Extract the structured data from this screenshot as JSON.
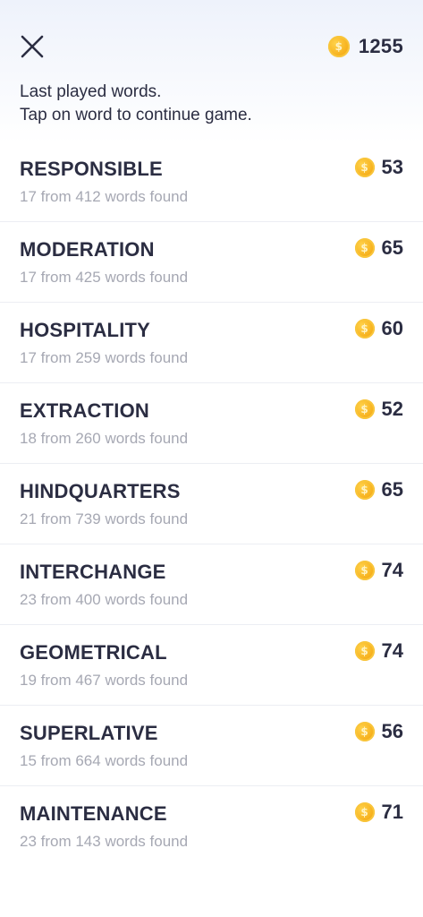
{
  "header": {
    "close_icon": "close-icon",
    "coin_icon": "coin-icon",
    "balance": "1255",
    "intro_line1": "Last played words.",
    "intro_line2": "Tap on word to continue game."
  },
  "colors": {
    "text_primary": "#2b2d42",
    "text_secondary": "#a6a8b3",
    "coin": "#f7b21f",
    "header_gradient_top": "#eef2fb"
  },
  "words": [
    {
      "word": "RESPONSIBLE",
      "progress": "17 from 412 words found",
      "coins": "53"
    },
    {
      "word": "MODERATION",
      "progress": "17 from 425 words found",
      "coins": "65"
    },
    {
      "word": "HOSPITALITY",
      "progress": "17 from 259 words found",
      "coins": "60"
    },
    {
      "word": "EXTRACTION",
      "progress": "18 from 260 words found",
      "coins": "52"
    },
    {
      "word": "HINDQUARTERS",
      "progress": "21 from 739 words found",
      "coins": "65"
    },
    {
      "word": "INTERCHANGE",
      "progress": "23 from 400 words found",
      "coins": "74"
    },
    {
      "word": "GEOMETRICAL",
      "progress": "19 from 467 words found",
      "coins": "74"
    },
    {
      "word": "SUPERLATIVE",
      "progress": "15 from 664 words found",
      "coins": "56"
    },
    {
      "word": "MAINTENANCE",
      "progress": "23 from 143 words found",
      "coins": "71"
    }
  ]
}
